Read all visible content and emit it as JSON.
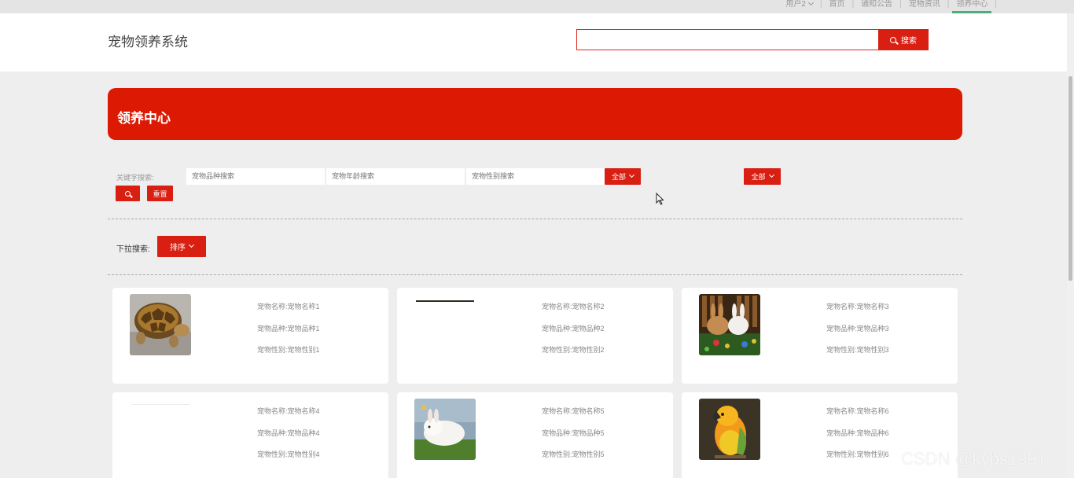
{
  "topnav": {
    "user": "用户2",
    "home": "首页",
    "notice": "通知公告",
    "news": "宠物资讯",
    "adopt": "领养中心"
  },
  "header": {
    "site_title": "宠物领养系统",
    "search_value": "",
    "search_button": "搜索"
  },
  "banner": {
    "title": "领养中心"
  },
  "filters": {
    "keyword_label": "关键字搜索:",
    "breed_placeholder": "宠物品种搜索",
    "age_placeholder": "宠物年龄搜索",
    "gender_placeholder": "宠物性别搜索",
    "select1": "全部",
    "select2": "全部",
    "reset": "重置"
  },
  "dropdown": {
    "label": "下拉搜索:",
    "sort": "排序"
  },
  "pets": [
    {
      "name": "宠物名称:宠物名称1",
      "breed": "宠物品种:宠物品种1",
      "gender": "宠物性别:宠物性别1",
      "image": "tortoise"
    },
    {
      "name": "宠物名称:宠物名称2",
      "breed": "宠物品种:宠物品种2",
      "gender": "宠物性别:宠物性别2",
      "image": "none"
    },
    {
      "name": "宠物名称:宠物名称3",
      "breed": "宠物品种:宠物品种3",
      "gender": "宠物性别:宠物性别3",
      "image": "rabbits"
    },
    {
      "name": "宠物名称:宠物名称4",
      "breed": "宠物品种:宠物品种4",
      "gender": "宠物性别:宠物性别4",
      "image": "none"
    },
    {
      "name": "宠物名称:宠物名称5",
      "breed": "宠物品种:宠物品种5",
      "gender": "宠物性别:宠物性别5",
      "image": "white-rabbit"
    },
    {
      "name": "宠物名称:宠物名称6",
      "breed": "宠物品种:宠物品种6",
      "gender": "宠物性别:宠物性别6",
      "image": "parrot"
    }
  ],
  "watermark": "CSDN @kybs1991",
  "colors": {
    "accent": "#dc1a04",
    "active_tab": "#4caf7a"
  }
}
